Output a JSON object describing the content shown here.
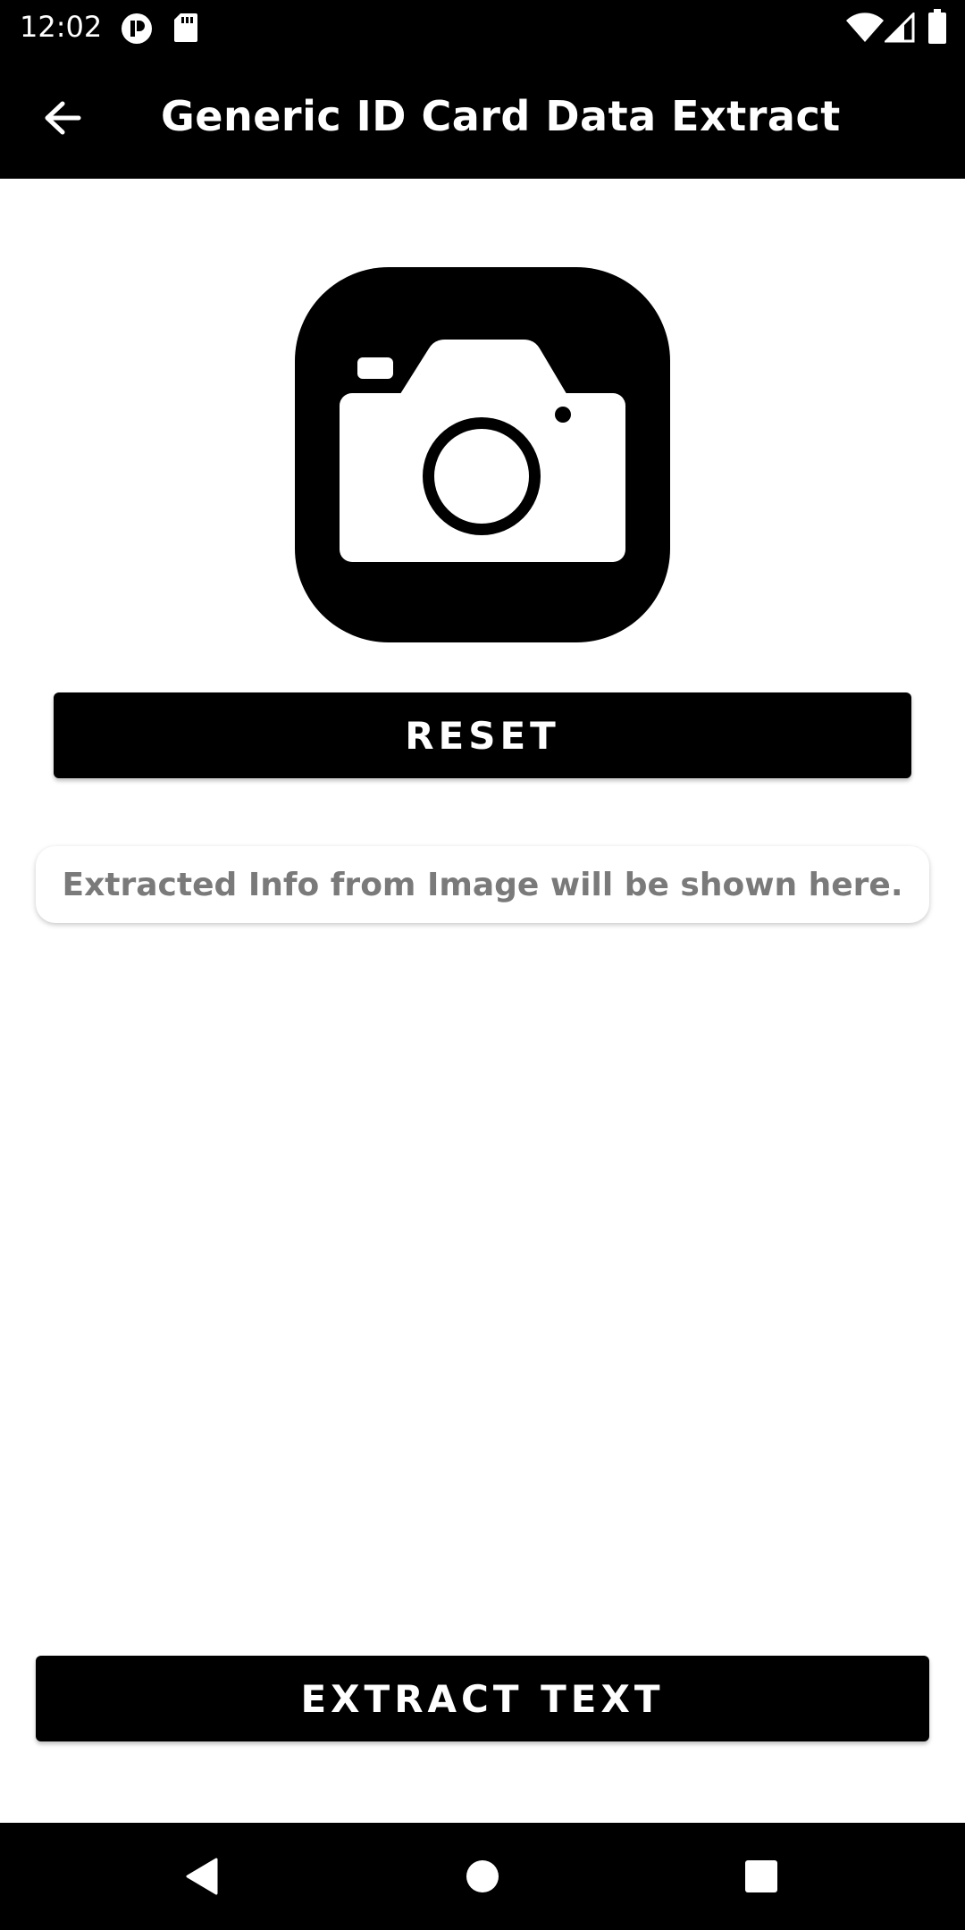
{
  "status_bar": {
    "time": "12:02",
    "icons": [
      "notification-p-icon",
      "sd-card-icon",
      "wifi-icon",
      "signal-icon",
      "battery-icon"
    ]
  },
  "app_bar": {
    "title": "Generic ID Card Data Extract",
    "back_icon": "arrow-back-icon"
  },
  "main": {
    "camera_icon": "camera-icon",
    "reset_label": "RESET",
    "info_placeholder": "Extracted Info from Image will be shown here.",
    "extract_label": "EXTRACT TEXT"
  },
  "nav_bar": {
    "icons": [
      "back-triangle-icon",
      "home-circle-icon",
      "recents-square-icon"
    ]
  },
  "colors": {
    "primary": "#000000",
    "background": "#ffffff",
    "placeholder_text": "#7a7a7a"
  }
}
